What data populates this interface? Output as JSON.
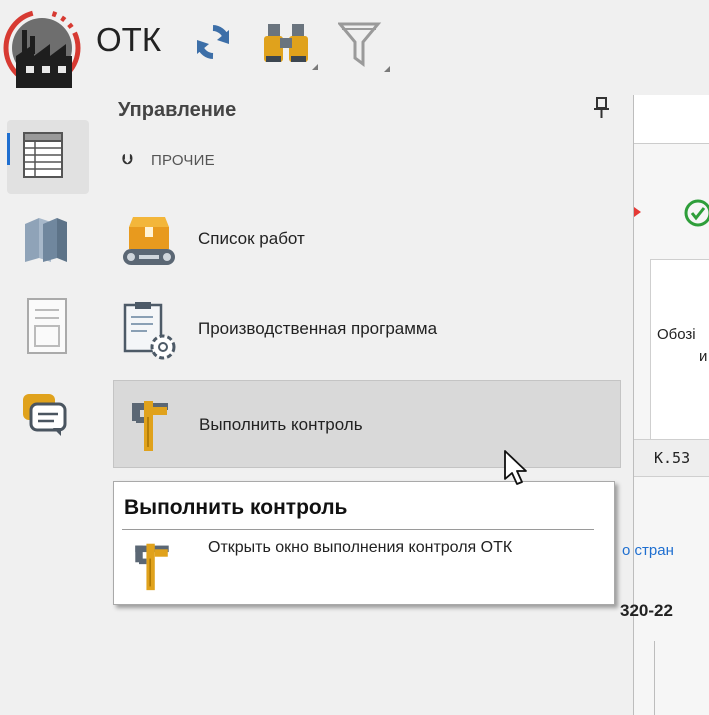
{
  "toolbar": {
    "app_title": "ОТК",
    "icons": [
      "app-logo-icon",
      "refresh-icon",
      "binoculars-icon",
      "filter-icon"
    ]
  },
  "nav_rail": {
    "items": [
      {
        "icon": "grid-list-icon",
        "active": true
      },
      {
        "icon": "books-icon",
        "active": false
      },
      {
        "icon": "document-icon",
        "active": false
      },
      {
        "icon": "chat-icon",
        "active": false
      }
    ]
  },
  "panel": {
    "title": "Управление",
    "section_label": "ПРОЧИЕ",
    "items": [
      {
        "label": "Список работ",
        "icon": "conveyor-box-icon"
      },
      {
        "label": "Производственная программа",
        "icon": "program-settings-icon"
      },
      {
        "label": "Выполнить контроль",
        "icon": "caliper-icon"
      }
    ]
  },
  "tooltip": {
    "title": "Выполнить контроль",
    "description": "Открыть окно выполнения контроля ОТК"
  },
  "right_panel": {
    "header_line1": "Обозі",
    "header_line2": "и",
    "cell_value": "К.53",
    "link_text": "о стран",
    "code_text": "320-22"
  },
  "colors": {
    "accent_blue": "#1f6fd0",
    "check_green": "#2e9e3a",
    "caliper_gray": "#5b6774",
    "caliper_gold": "#e0a21c"
  }
}
